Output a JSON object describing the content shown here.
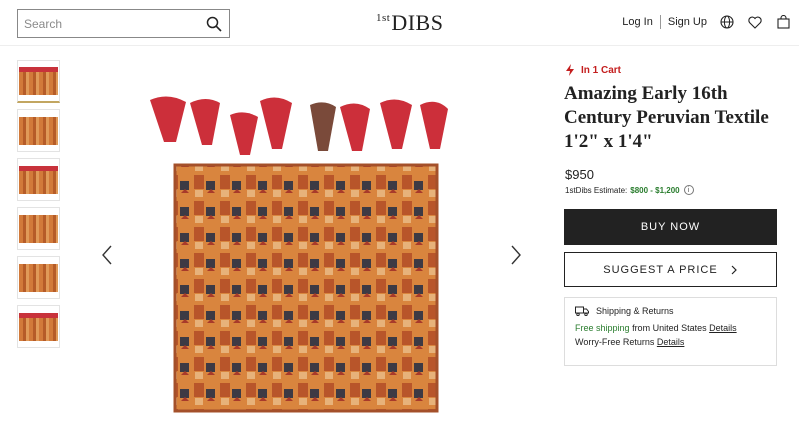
{
  "header": {
    "search_placeholder": "Search",
    "logo_prefix": "1st",
    "logo_text": "DIBS",
    "login": "Log In",
    "signup": "Sign Up"
  },
  "gallery": {
    "thumbnail_count": 6,
    "active_thumbnail": 1
  },
  "product": {
    "cart_notice": "In 1 Cart",
    "title": "Amazing Early 16th Century Peruvian Textile 1'2\" x 1'4\"",
    "price": "$950",
    "estimate_label": "1stDibs Estimate:",
    "estimate_range": "$800 - $1,200",
    "buy_label": "BUY NOW",
    "suggest_label": "SUGGEST A PRICE"
  },
  "shipping": {
    "heading": "Shipping & Returns",
    "free_label": "Free shipping",
    "from_text": "from United States",
    "details1": "Details",
    "returns_text": "Worry-Free Returns",
    "details2": "Details"
  },
  "colors": {
    "accent_red": "#c41e1e",
    "estimate_green": "#2a7d2e",
    "button_dark": "#222222"
  }
}
